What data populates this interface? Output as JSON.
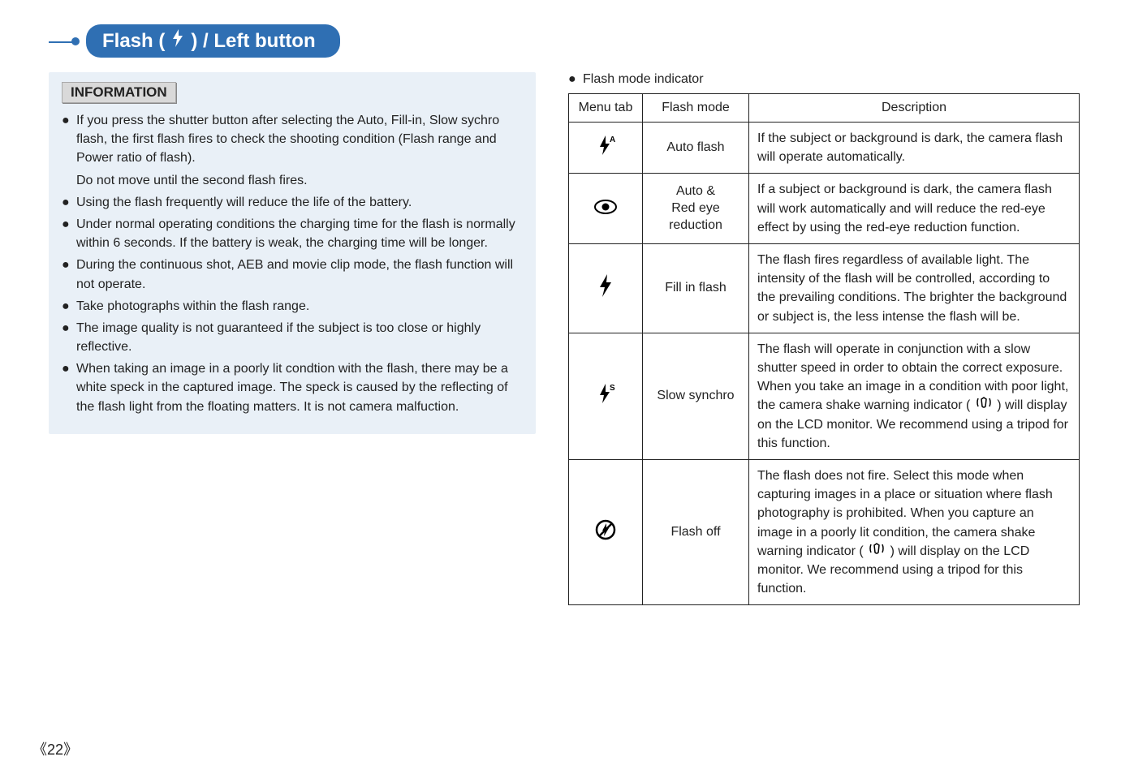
{
  "title": {
    "prefix": "Flash (",
    "suffix": ") / Left button"
  },
  "information": {
    "label": "INFORMATION",
    "items": [
      "If you press the shutter button after selecting the Auto, Fill-in, Slow sychro flash, the first flash fires to check the shooting condition (Flash range and Power ratio of flash).",
      "Using the flash frequently will reduce the life of the battery.",
      "Under normal operating conditions the charging time for the flash is normally within 6 seconds. If the battery is weak, the charging time will be longer.",
      "During the continuous shot, AEB and movie clip mode, the flash function will not operate.",
      "Take photographs within the flash range.",
      "The image quality is not guaranteed if the subject is too close or highly reflective.",
      "When taking an image in a poorly lit condtion with the flash, there may be a white speck in the captured image. The speck is caused by the reflecting of the flash light from the floating matters. It is not camera malfuction."
    ],
    "sub_after_0": "Do not move until the second flash fires."
  },
  "right": {
    "header": "Flash mode indicator",
    "columns": {
      "menu_tab": "Menu tab",
      "flash_mode": "Flash mode",
      "description": "Description"
    },
    "rows": [
      {
        "icon": "auto-flash",
        "mode_lines": [
          "Auto flash"
        ],
        "desc": "If the subject or background is dark, the camera flash will operate automatically."
      },
      {
        "icon": "red-eye",
        "mode_lines": [
          "Auto &",
          "Red eye",
          "reduction"
        ],
        "desc": "If a subject or background is dark, the camera flash will work automatically and will reduce the red-eye effect by using the red-eye reduction function."
      },
      {
        "icon": "fill-flash",
        "mode_lines": [
          "Fill in flash"
        ],
        "desc": "The flash fires regardless of available light. The intensity of the flash will be controlled, according to the prevailing conditions. The brighter the background or subject is, the less intense the flash will be."
      },
      {
        "icon": "slow-synchro",
        "mode_lines": [
          "Slow synchro"
        ],
        "desc_parts": {
          "p1": "The flash will operate in conjunction with a slow shutter speed in order to obtain the correct exposure. When you take an image in a condition with poor light, the camera shake warning indicator (",
          "p2": ") will display on the LCD monitor. We recommend using a tripod for this function."
        }
      },
      {
        "icon": "flash-off",
        "mode_lines": [
          "Flash off"
        ],
        "desc_parts": {
          "p1": "The flash does not fire. Select this mode when capturing images in a place or situation where flash photography is prohibited. When you capture an image in a poorly lit condition, the camera shake warning indicator (",
          "p2": ") will display on the LCD monitor. We recommend using a tripod for this function."
        }
      }
    ]
  },
  "page_num": "《22》"
}
